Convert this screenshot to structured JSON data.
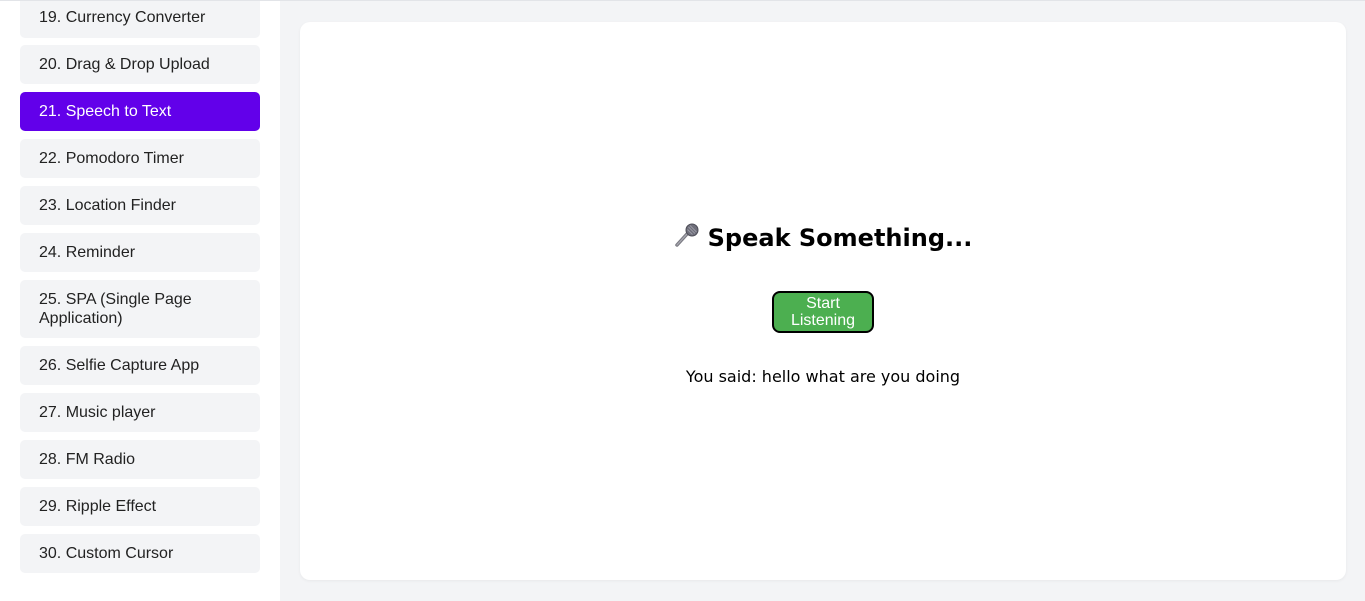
{
  "sidebar": {
    "items": [
      {
        "label": "19. Currency Converter",
        "active": false
      },
      {
        "label": "20. Drag & Drop Upload",
        "active": false
      },
      {
        "label": "21. Speech to Text",
        "active": true
      },
      {
        "label": "22. Pomodoro Timer",
        "active": false
      },
      {
        "label": "23. Location Finder",
        "active": false
      },
      {
        "label": "24. Reminder",
        "active": false
      },
      {
        "label": "25. SPA (Single Page Application)",
        "active": false
      },
      {
        "label": "26. Selfie Capture App",
        "active": false
      },
      {
        "label": "27. Music player",
        "active": false
      },
      {
        "label": "28. FM Radio",
        "active": false
      },
      {
        "label": "29. Ripple Effect",
        "active": false
      },
      {
        "label": "30. Custom Cursor",
        "active": false
      }
    ]
  },
  "main": {
    "icon": "microphone-icon",
    "title": "Speak Something...",
    "button_label": "Start Listening",
    "result_text": "You said: hello what are you doing"
  },
  "colors": {
    "accent": "#6200ea",
    "button": "#4caf50"
  }
}
